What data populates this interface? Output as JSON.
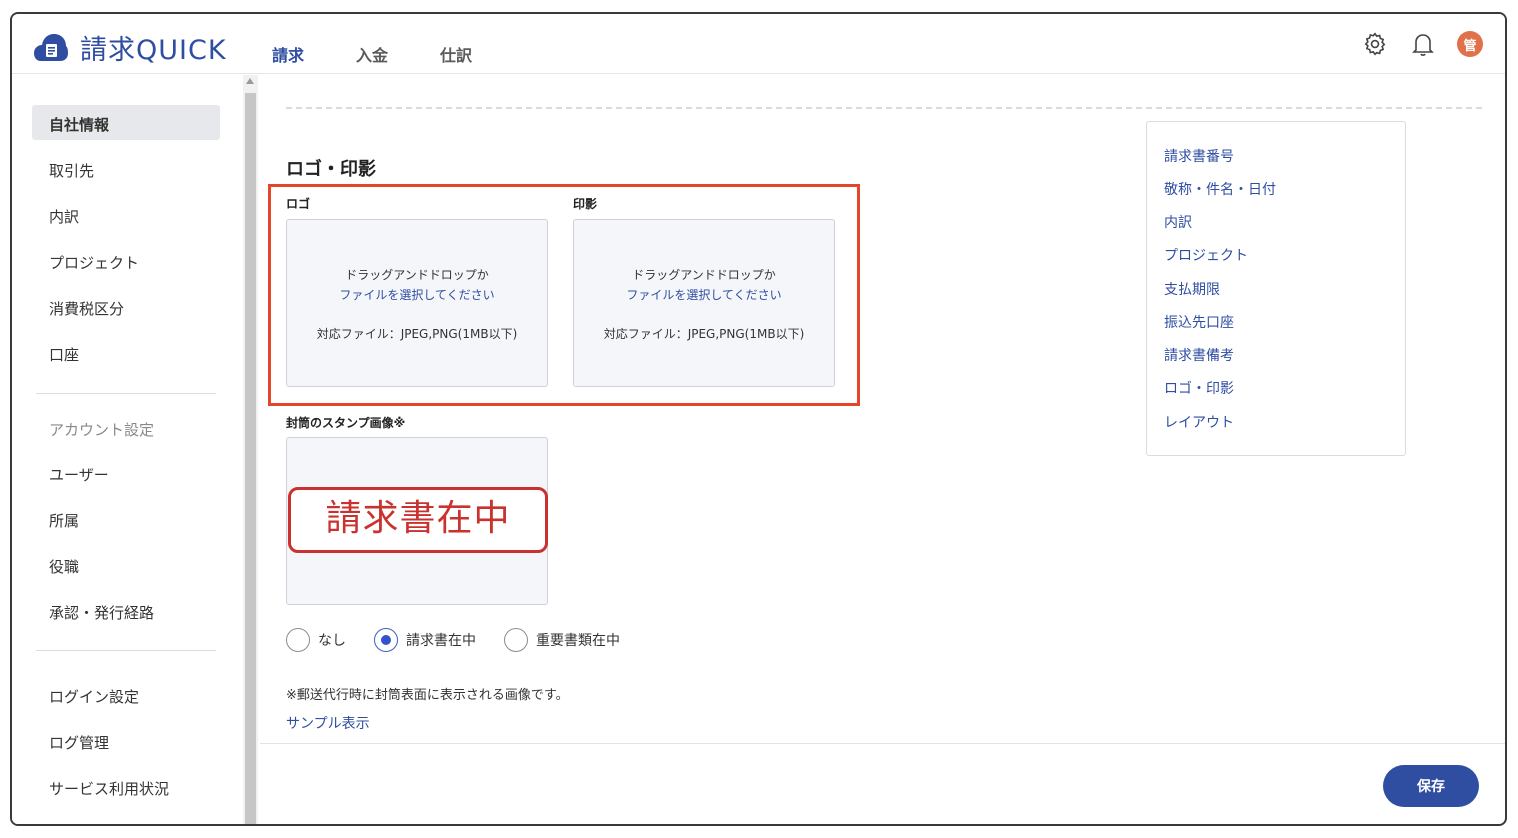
{
  "app": {
    "logo_text": "請求QUICK"
  },
  "topnav": {
    "tabs": [
      "請求",
      "入金",
      "仕訳"
    ]
  },
  "header": {
    "avatar_initial": "管"
  },
  "sidebar": {
    "items": [
      "自社情報",
      "取引先",
      "内訳",
      "プロジェクト",
      "消費税区分",
      "口座"
    ],
    "account_section": "アカウント設定",
    "account_items": [
      "ユーザー",
      "所属",
      "役職",
      "承認・発行経路"
    ],
    "other_items": [
      "ログイン設定",
      "ログ管理",
      "サービス利用状況"
    ]
  },
  "main": {
    "section_title": "ロゴ・印影",
    "logo_label": "ロゴ",
    "seal_label": "印影",
    "dropzone": {
      "line1": "ドラッグアンドドロップか",
      "line2": "ファイルを選択してください",
      "line3": "対応ファイル：JPEG,PNG(1MB以下)"
    },
    "stamp_label": "封筒のスタンプ画像※",
    "stamp_text": "請求書在中",
    "radio_options": [
      "なし",
      "請求書在中",
      "重要書類在中"
    ],
    "selected_radio": "請求書在中",
    "note": "※郵送代行時に封筒表面に表示される画像です。",
    "sample_link": "サンプル表示",
    "save_label": "保存"
  },
  "toc": {
    "items": [
      "請求書番号",
      "敬称・件名・日付",
      "内訳",
      "プロジェクト",
      "支払期限",
      "振込先口座",
      "請求書備考",
      "ロゴ・印影",
      "レイアウト"
    ]
  },
  "colors": {
    "brand": "#2f4ea2",
    "highlight": "#e4462c",
    "stamp": "#c9322e"
  },
  "icons": [
    "gear-icon",
    "bell-icon"
  ]
}
